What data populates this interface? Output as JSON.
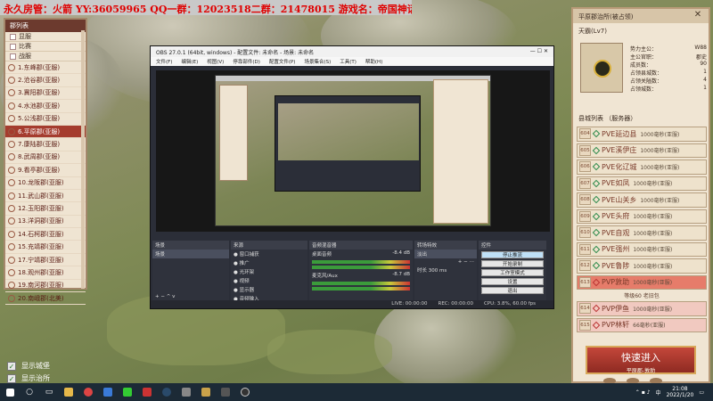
{
  "overlay": {
    "title": "永久房管：火箭 YY:36059965 QQ一群：12023518二群：21478015 游戏名：帝国神话"
  },
  "left_panel": {
    "header": "郡列表",
    "filters": [
      "显服",
      "比赛",
      "战服"
    ],
    "provinces": [
      {
        "label": "1.东峰郡(亚服)",
        "selected": false
      },
      {
        "label": "2.沧谷郡(亚服)",
        "selected": false
      },
      {
        "label": "3.冀阳郡(亚服)",
        "selected": false
      },
      {
        "label": "4.水池郡(亚服)",
        "selected": false
      },
      {
        "label": "5.公浅郡(亚服)",
        "selected": false
      },
      {
        "label": "6.平原郡(亚服)",
        "selected": true
      },
      {
        "label": "7.康陆郡(亚服)",
        "selected": false
      },
      {
        "label": "8.武周郡(亚服)",
        "selected": false
      },
      {
        "label": "9.看亭郡(亚服)",
        "selected": false
      },
      {
        "label": "10.龙阪郡(亚服)",
        "selected": false
      },
      {
        "label": "11.武山郡(亚服)",
        "selected": false
      },
      {
        "label": "12.玉阳郡(亚服)",
        "selected": false
      },
      {
        "label": "13.洋洞郡(亚服)",
        "selected": false
      },
      {
        "label": "14.石柯郡(亚服)",
        "selected": false
      },
      {
        "label": "15.充靖郡(亚服)",
        "selected": false
      },
      {
        "label": "17.宁靖郡(亚服)",
        "selected": false
      },
      {
        "label": "18.观州郡(亚服)",
        "selected": false
      },
      {
        "label": "19.南河郡(亚服)",
        "selected": false
      },
      {
        "label": "20.南峨郡(北美)",
        "selected": false
      }
    ]
  },
  "bottom_toggles": {
    "show_city": "显示城堡",
    "show_route": "显示治所"
  },
  "obs": {
    "title": "OBS 27.0.1 (64bit, windows) - 配置文件: 未命名 - 场景: 未命名",
    "menu": [
      "文件(F)",
      "编辑(E)",
      "视图(V)",
      "停靠部件(D)",
      "配置文件(P)",
      "场景集合(S)",
      "工具(T)",
      "帮助(H)"
    ],
    "docks": {
      "scenes": {
        "title": "场景",
        "items": [
          "场景"
        ]
      },
      "sources": {
        "title": "来源",
        "items": [
          "窗口捕获",
          "推广",
          "光环架",
          "视频",
          "显示器",
          "音频输入"
        ]
      },
      "mixer": {
        "title": "音频混音器",
        "tracks": [
          {
            "name": "桌面音频",
            "db": "-8.4 dB"
          },
          {
            "name": "麦克风/Aux",
            "db": "-8.7 dB"
          }
        ]
      },
      "transitions": {
        "title": "转场特效",
        "type": "淡出",
        "duration_label": "时长",
        "duration": "300 ms"
      },
      "controls": {
        "title": "控件",
        "buttons": [
          "停止推流",
          "开始录制",
          "工作室模式",
          "设置",
          "退出"
        ]
      }
    },
    "status": {
      "live": "LIVE: 00:00:00",
      "rec": "REC: 00:00:00",
      "cpu": "CPU: 3.8%, 60.00 fps"
    }
  },
  "right_panel": {
    "title": "平原郡治所(被占领)",
    "lord": "天霸(Lv7)",
    "stats": [
      {
        "label": "势力主公：",
        "value": "W88"
      },
      {
        "label": "主公官职：",
        "value": "郡史"
      },
      {
        "label": "成员数：",
        "value": "90"
      },
      {
        "label": "占领县城数：",
        "value": "1"
      },
      {
        "label": "占领关隘数：",
        "value": "4"
      },
      {
        "label": "占领城数：",
        "value": "1"
      }
    ],
    "server_list_label": "县城列表 （服务器）",
    "servers": [
      {
        "num": "604",
        "name": "PVE延边县",
        "time": "1000毫秒(亚服)",
        "mode": "pve"
      },
      {
        "num": "605",
        "name": "PVE溪伊庄",
        "time": "1000毫秒(亚服)",
        "mode": "pve"
      },
      {
        "num": "606",
        "name": "PVE化辽城",
        "time": "1000毫秒(亚服)",
        "mode": "pve"
      },
      {
        "num": "607",
        "name": "PVE如凤",
        "time": "1000毫秒(亚服)",
        "mode": "pve"
      },
      {
        "num": "608",
        "name": "PVE山关乡",
        "time": "1000毫秒(亚服)",
        "mode": "pve"
      },
      {
        "num": "609",
        "name": "PVE头府",
        "time": "1000毫秒(亚服)",
        "mode": "pve"
      },
      {
        "num": "610",
        "name": "PVE自观",
        "time": "1000毫秒(亚服)",
        "mode": "pve"
      },
      {
        "num": "611",
        "name": "PVE强州",
        "time": "1000毫秒(亚服)",
        "mode": "pve"
      },
      {
        "num": "612",
        "name": "PVE鲁陟",
        "time": "1000毫秒(亚服)",
        "mode": "pve"
      },
      {
        "num": "613",
        "name": "PVP敦助",
        "time": "1000毫秒(亚服)",
        "mode": "pvp-hl"
      },
      {
        "num": "614",
        "name": "PVP伊鱼",
        "time": "1000毫秒(亚服)",
        "mode": "pvp"
      },
      {
        "num": "615",
        "name": "PVP林轩",
        "time": "66毫秒(亚服)",
        "mode": "pvp"
      }
    ],
    "queue_text": "等级60 老旧包",
    "quick_enter": {
      "label": "快速进入",
      "sub": "平原郡-敦助"
    }
  },
  "taskbar": {
    "lang": "中",
    "time": "21:08",
    "date": "2022/1/20"
  }
}
